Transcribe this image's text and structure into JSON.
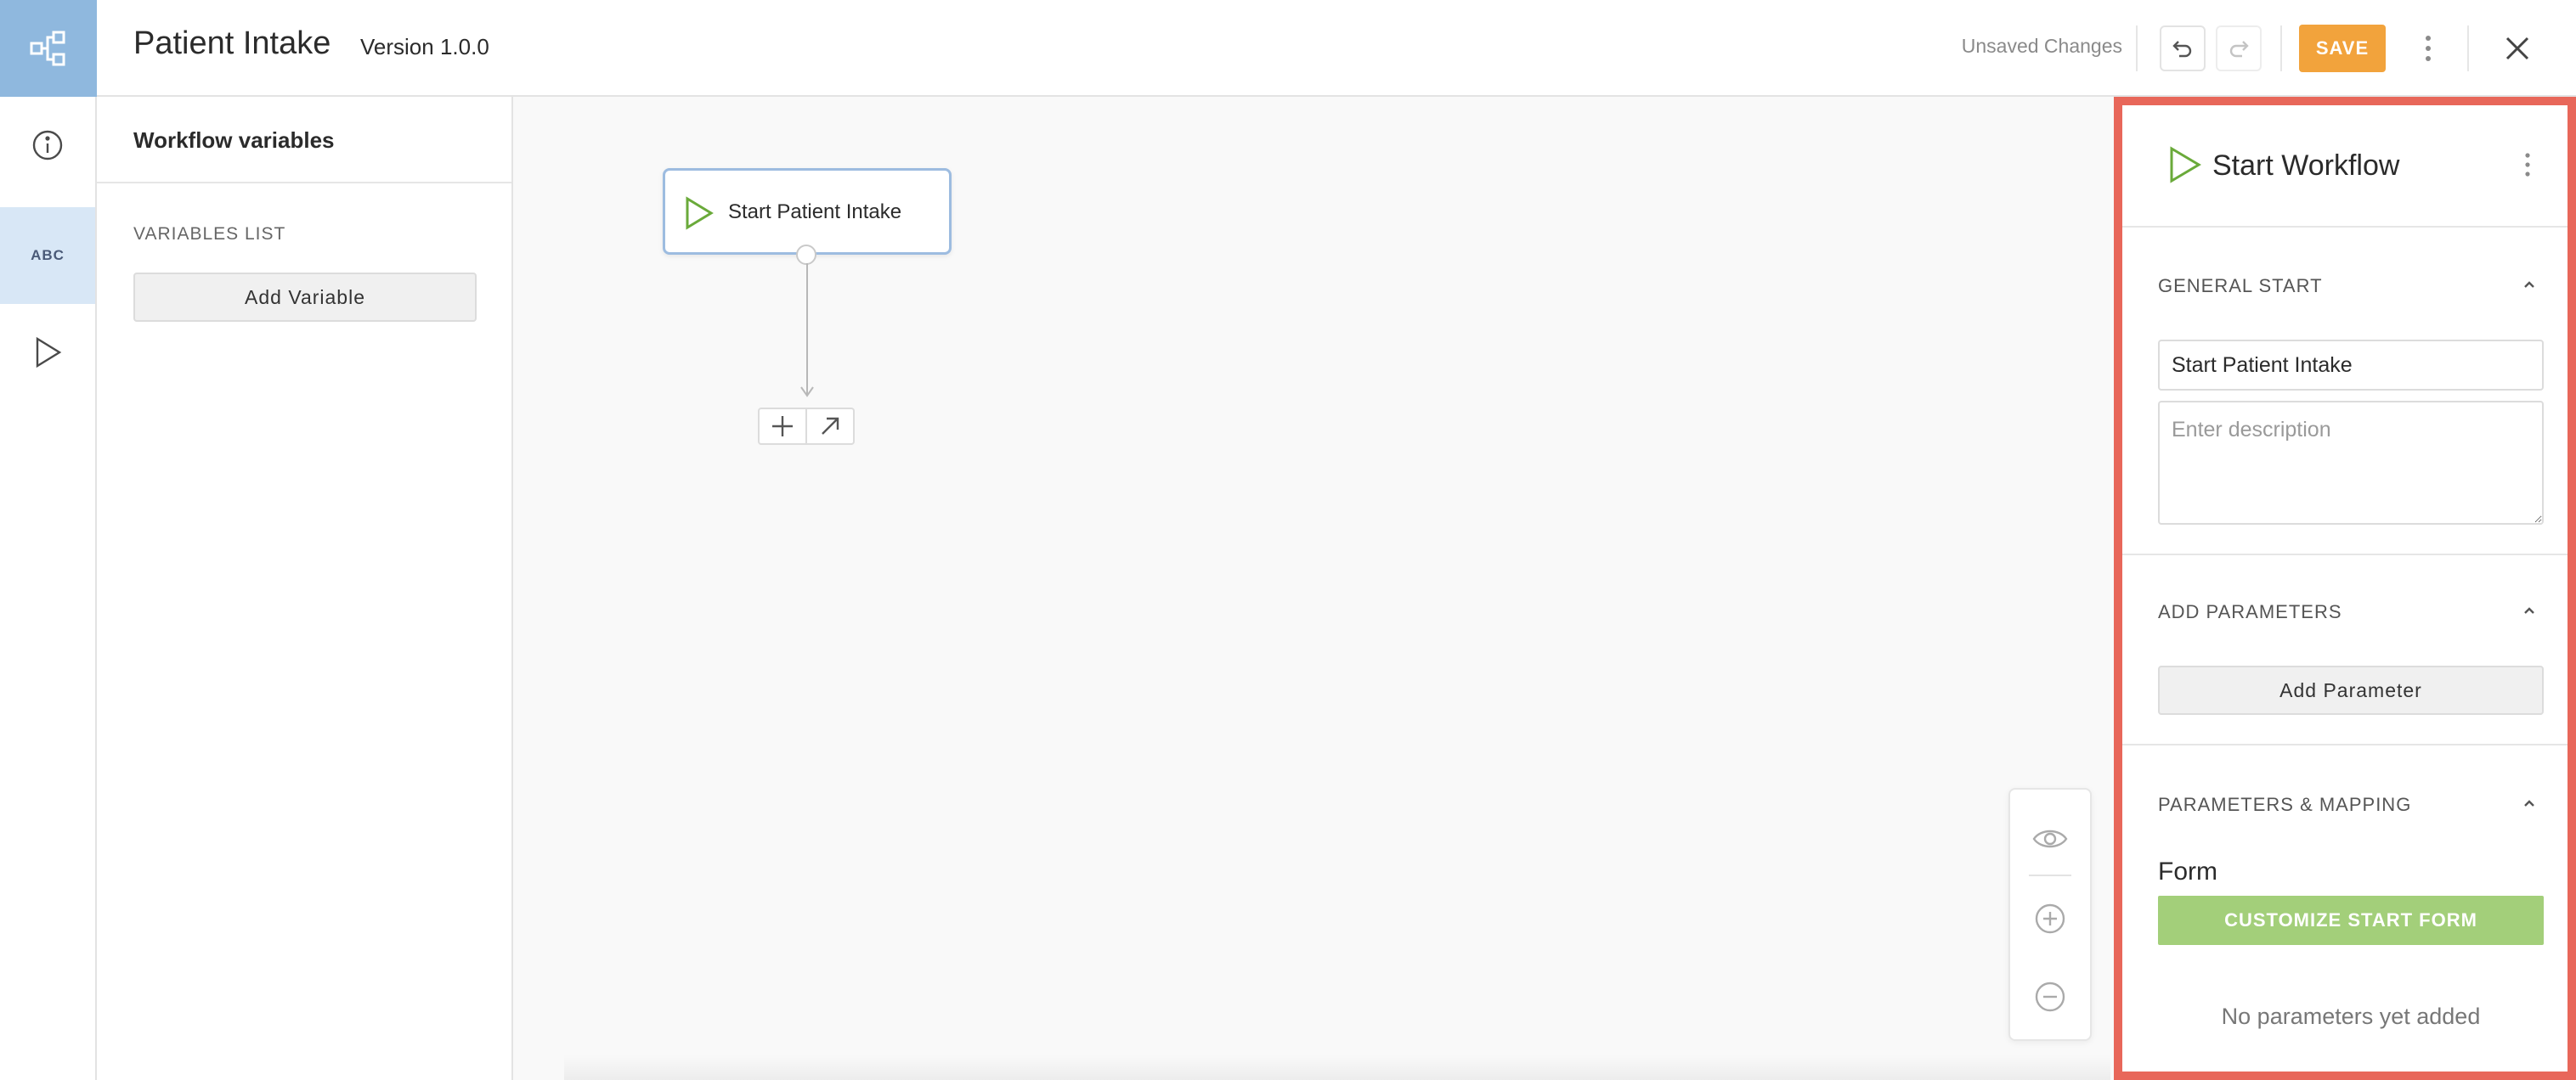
{
  "header": {
    "title": "Patient Intake",
    "version": "Version 1.0.0",
    "status": "Unsaved Changes",
    "save_label": "SAVE"
  },
  "rail": {
    "items": [
      {
        "name": "info-icon"
      },
      {
        "name": "variables-abc-icon",
        "label": "ABC",
        "active": true
      },
      {
        "name": "play-icon"
      }
    ]
  },
  "variables_panel": {
    "title": "Workflow variables",
    "list_label": "VARIABLES LIST",
    "add_button": "Add Variable"
  },
  "canvas": {
    "start_node": {
      "label": "Start Patient Intake"
    }
  },
  "properties": {
    "title": "Start Workflow",
    "general": {
      "label": "GENERAL START",
      "name_value": "Start Patient Intake",
      "description_placeholder": "Enter description"
    },
    "parameters": {
      "label": "ADD PARAMETERS",
      "add_button": "Add Parameter"
    },
    "mapping": {
      "label": "PARAMETERS & MAPPING",
      "form_label": "Form",
      "customize_button": "CUSTOMIZE START FORM",
      "empty_text": "No parameters yet added"
    }
  },
  "colors": {
    "logo_bg": "#8fb8de",
    "save": "#f2a33c",
    "start_green": "#6aaa3a",
    "customize": "#a3cf7a",
    "highlight_border": "#e8675a",
    "node_border": "#9dbce0"
  }
}
